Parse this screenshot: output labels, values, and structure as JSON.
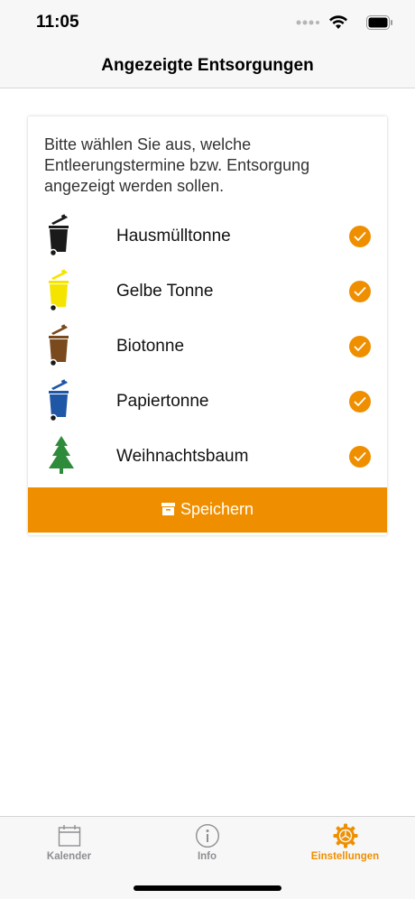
{
  "status_bar": {
    "time": "11:05"
  },
  "nav": {
    "title": "Angezeigte Entsorgungen"
  },
  "card": {
    "intro": "Bitte wählen Sie aus, welche Entleerungstermine bzw. Entsorgung angezeigt werden sollen.",
    "bins": [
      {
        "label": "Hausmülltonne",
        "checked": true,
        "color": "#1a1a1a",
        "icon": "black-bin-icon"
      },
      {
        "label": "Gelbe Tonne",
        "checked": true,
        "color": "#f5e400",
        "icon": "yellow-bin-icon"
      },
      {
        "label": "Biotonne",
        "checked": true,
        "color": "#7a4a1e",
        "icon": "brown-bin-icon"
      },
      {
        "label": "Papiertonne",
        "checked": true,
        "color": "#1f57a6",
        "icon": "blue-bin-icon"
      },
      {
        "label": "Weihnachtsbaum",
        "checked": true,
        "color": "#2e8b3a",
        "icon": "christmas-tree-icon"
      }
    ],
    "save_label": "Speichern"
  },
  "tabs": [
    {
      "label": "Kalender",
      "icon": "calendar-icon",
      "active": false
    },
    {
      "label": "Info",
      "icon": "info-icon",
      "active": false
    },
    {
      "label": "Einstellungen",
      "icon": "gear-icon",
      "active": true
    }
  ],
  "colors": {
    "accent": "#ef8f00",
    "tab_inactive": "#8e8e93"
  }
}
